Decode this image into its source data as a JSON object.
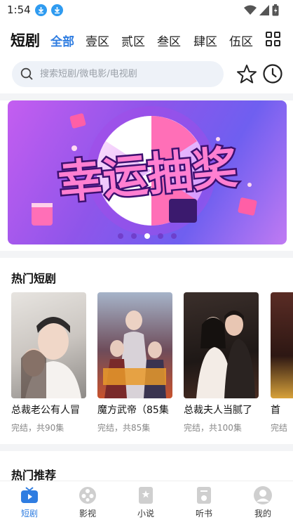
{
  "status": {
    "time": "1:54"
  },
  "nav": {
    "brand": "短剧",
    "tabs": [
      "全部",
      "壹区",
      "贰区",
      "叁区",
      "肆区",
      "伍区"
    ],
    "active_tab": 0
  },
  "search": {
    "placeholder": "搜索短剧/微电影/电视剧"
  },
  "banner": {
    "text": "幸运抽奖",
    "slide_count": 5,
    "active_slide": 2
  },
  "hot_dramas": {
    "title": "热门短剧",
    "items": [
      {
        "title": "总裁老公有人冒",
        "meta": "完结，共90集"
      },
      {
        "title": "魔方武帝（85集",
        "meta": "完结，共85集"
      },
      {
        "title": "总裁夫人当腻了",
        "meta": "完结，共100集"
      },
      {
        "title": "首",
        "meta": "完结"
      }
    ]
  },
  "recommend": {
    "title": "热门推荐"
  },
  "bottom_nav": {
    "items": [
      "短剧",
      "影视",
      "小说",
      "听书",
      "我的"
    ],
    "active": 0
  },
  "colors": {
    "accent": "#2f7de1",
    "download_badge": "#2f9bf0"
  }
}
